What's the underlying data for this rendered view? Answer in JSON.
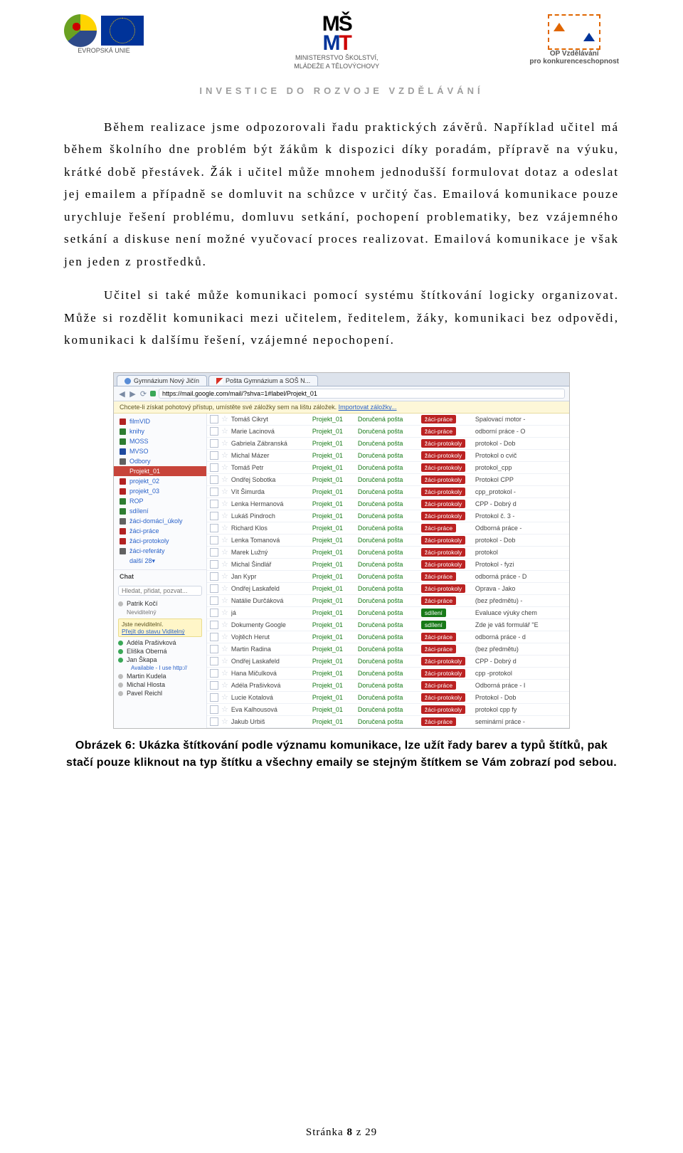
{
  "header": {
    "esf": {
      "eu_text": "EVROPSKÁ UNIE"
    },
    "msmt": {
      "line1": "MINISTERSTVO ŠKOLSTVÍ,",
      "line2": "MLÁDEŽE A TĚLOVÝCHOVY"
    },
    "op": {
      "line1": "OP Vzdělávání",
      "line2": "pro konkurenceschopnost"
    },
    "tagline": "INVESTICE DO ROZVOJE VZDĚLÁVÁNÍ"
  },
  "paragraphs": {
    "p1": "Během realizace jsme odpozorovali řadu praktických závěrů. Například učitel má během školního dne problém být žákům k dispozici díky poradám, přípravě na výuku, krátké době přestávek. Žák i učitel může mnohem jednodušší formulovat dotaz a odeslat jej emailem a případně se domluvit na schůzce v určitý čas. Emailová komunikace pouze urychluje řešení problému, domluvu setkání, pochopení problematiky, bez vzájemného setkání a diskuse není možné vyučovací proces realizovat. Emailová komunikace je však jen jeden z prostředků.",
    "p2": "Učitel si také může komunikaci pomocí systému štítkování logicky organizovat. Může si rozdělit komunikaci mezi učitelem, ředitelem, žáky, komunikaci bez odpovědi, komunikaci k dalšímu řešení, vzájemné nepochopení."
  },
  "screenshot": {
    "tabs": [
      "Gymnázium Nový Jičín",
      "Pošta Gymnázium a SOŠ N..."
    ],
    "url": "https://mail.google.com/mail/?shva=1#label/Projekt_01",
    "infobar_a": "Chcete-li získat pohotový přístup, umístěte své záložky sem na lištu záložek. ",
    "infobar_link": "Importovat záložky...",
    "labels": [
      {
        "name": "filmVID",
        "color": "#b22222"
      },
      {
        "name": "knihy",
        "color": "#2e7d32"
      },
      {
        "name": "MOSS",
        "color": "#2e7d32"
      },
      {
        "name": "MVSO",
        "color": "#1f4aa0"
      },
      {
        "name": "Odbory",
        "color": "#616161"
      },
      {
        "name": "Projekt_01",
        "color": "#c7443a",
        "active": true
      },
      {
        "name": "projekt_02",
        "color": "#b22222"
      },
      {
        "name": "projekt_03",
        "color": "#b22222"
      },
      {
        "name": "ROP",
        "color": "#2e7d32"
      },
      {
        "name": "sdílení",
        "color": "#2e7d32"
      },
      {
        "name": "žáci-domácí_úkoly",
        "color": "#616161"
      },
      {
        "name": "žáci-práce",
        "color": "#b22222"
      },
      {
        "name": "žáci-protokoly",
        "color": "#b22222"
      },
      {
        "name": "žáci-referáty",
        "color": "#616161"
      },
      {
        "name": "další 28▾",
        "color": "transparent"
      }
    ],
    "chat_title": "Chat",
    "chat_search": "Hledat, přidat, pozvat...",
    "presence_self": "Patrik Kočí",
    "presence_state": "Neviditelný",
    "presence_warn_a": "Jste neviditelní.",
    "presence_warn_link": "Přejít do stavu Viditelný",
    "contacts": [
      {
        "name": "Adéla Prašivková",
        "dot": "#3aa757"
      },
      {
        "name": "Eliška Oberná",
        "dot": "#3aa757"
      },
      {
        "name": "Jan Škapa",
        "dot": "#3aa757",
        "extra": "Available - I use http://"
      },
      {
        "name": "Martin Kudela",
        "dot": "#bbb"
      },
      {
        "name": "Michal Hlosta",
        "dot": "#bbb"
      },
      {
        "name": "Pavel Reichl",
        "dot": "#bbb"
      }
    ],
    "rows": [
      {
        "from": "Tomáš Cikryt",
        "t": "žáci-práce",
        "tc": "#b22",
        "s": "Spalovací motor -"
      },
      {
        "from": "Marie Lacinová",
        "t": "žáci-práce",
        "tc": "#b22",
        "s": "odborní práce - O"
      },
      {
        "from": "Gabriela Zábranská",
        "t": "žáci-protokoly",
        "tc": "#b22",
        "s": "protokol - Dob"
      },
      {
        "from": "Michal Mázer",
        "t": "žáci-protokoly",
        "tc": "#b22",
        "s": "Protokol o cvič"
      },
      {
        "from": "Tomáš Petr",
        "t": "žáci-protokoly",
        "tc": "#b22",
        "s": "protokol_cpp"
      },
      {
        "from": "Ondřej Sobotka",
        "t": "žáci-protokoly",
        "tc": "#b22",
        "s": "Protokol CPP"
      },
      {
        "from": "Vít Šimurda",
        "t": "žáci-protokoly",
        "tc": "#b22",
        "s": "cpp_protokol -"
      },
      {
        "from": "Lenka Hermanová",
        "t": "žáci-protokoly",
        "tc": "#b22",
        "s": "CPP - Dobrý d"
      },
      {
        "from": "Lukáš Pindroch",
        "t": "žáci-protokoly",
        "tc": "#b22",
        "s": "Protokol č. 3 -"
      },
      {
        "from": "Richard Klos",
        "t": "žáci-práce",
        "tc": "#b22",
        "s": "Odborná práce -"
      },
      {
        "from": "Lenka Tomanová",
        "t": "žáci-protokoly",
        "tc": "#b22",
        "s": "protokol - Dob"
      },
      {
        "from": "Marek Lužný",
        "t": "žáci-protokoly",
        "tc": "#b22",
        "s": "protokol"
      },
      {
        "from": "Michal Šindlář",
        "t": "žáci-protokoly",
        "tc": "#b22",
        "s": "Protokol - fyzi"
      },
      {
        "from": "Jan Kypr",
        "t": "žáci-práce",
        "tc": "#b22",
        "s": "odborná práce - D"
      },
      {
        "from": "Ondřej Laskafeld",
        "t": "žáci-protokoly",
        "tc": "#b22",
        "s": "Oprava - Jako"
      },
      {
        "from": "Natálie Durčáková",
        "t": "žáci-práce",
        "tc": "#b22",
        "s": "(bez předmětu) -"
      },
      {
        "from": "já",
        "t": "sdílení",
        "tc": "#187a18",
        "s": "Evaluace výuky chem"
      },
      {
        "from": "Dokumenty Google",
        "t": "sdílení",
        "tc": "#187a18",
        "s": "Zde je váš formulář \"E"
      },
      {
        "from": "Vojtěch Herut",
        "t": "žáci-práce",
        "tc": "#b22",
        "s": "odborná práce - d"
      },
      {
        "from": "Martin Radina",
        "t": "žáci-práce",
        "tc": "#b22",
        "s": "(bez předmětu)"
      },
      {
        "from": "Ondřej Laskafeld",
        "t": "žáci-protokoly",
        "tc": "#b22",
        "s": "CPP - Dobrý d"
      },
      {
        "from": "Hana Mičulková",
        "t": "žáci-protokoly",
        "tc": "#b22",
        "s": "cpp -protokol"
      },
      {
        "from": "Adéla Prašivková",
        "t": "žáci-práce",
        "tc": "#b22",
        "s": "Odborná práce - I"
      },
      {
        "from": "Lucie Kotalová",
        "t": "žáci-protokoly",
        "tc": "#b22",
        "s": "Protokol - Dob"
      },
      {
        "from": "Eva Kalhousová",
        "t": "žáci-protokoly",
        "tc": "#b22",
        "s": "protokol cpp fy"
      },
      {
        "from": "Jakub Urbiš",
        "t": "žáci-práce",
        "tc": "#b22",
        "s": "seminární práce -"
      }
    ],
    "col_lbl1": "Projekt_01",
    "col_lbl2": "Doručená pošta"
  },
  "caption": "Obrázek 6: Ukázka štítkování podle významu komunikace, lze užít řady barev a typů štítků, pak stačí pouze kliknout na typ štítku a všechny emaily se stejným štítkem se Vám zobrazí pod sebou.",
  "footer_a": "Stránka ",
  "footer_b": "8",
  "footer_c": " z ",
  "footer_d": "29"
}
